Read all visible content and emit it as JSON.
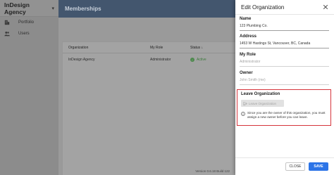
{
  "sidebar": {
    "brand": "InDesign Agency",
    "items": [
      {
        "label": "Portfolio",
        "icon": "building-icon"
      },
      {
        "label": "Users",
        "icon": "users-icon"
      }
    ]
  },
  "header": {
    "title": "Memberships"
  },
  "table": {
    "columns": [
      "Organization",
      "My Role",
      "Status"
    ],
    "rows": [
      {
        "organization": "InDesign Agency",
        "role": "Administrator",
        "status": "Active"
      }
    ]
  },
  "footer": {
    "version": "Version 0.6.18 Build 122"
  },
  "drawer": {
    "title": "Edit Organization",
    "fields": {
      "name": {
        "label": "Name",
        "value": "123 Plumbing Co."
      },
      "address": {
        "label": "Address",
        "value": "1453 W Hastings St, Vancouver, BC, Canada"
      },
      "role": {
        "label": "My Role",
        "value": "Administrator"
      },
      "owner": {
        "label": "Owner",
        "value": "John Smith (me)"
      }
    },
    "leave": {
      "title": "Leave Organization",
      "button": "Leave Organization",
      "note": "Since you are the owner of this organization, you must assign a new owner before you can leave."
    },
    "buttons": {
      "close": "CLOSE",
      "save": "SAVE"
    }
  },
  "colors": {
    "accent": "#2c74e7",
    "header": "#43566e",
    "highlight": "#d6343c",
    "active": "#3b7a3b"
  }
}
